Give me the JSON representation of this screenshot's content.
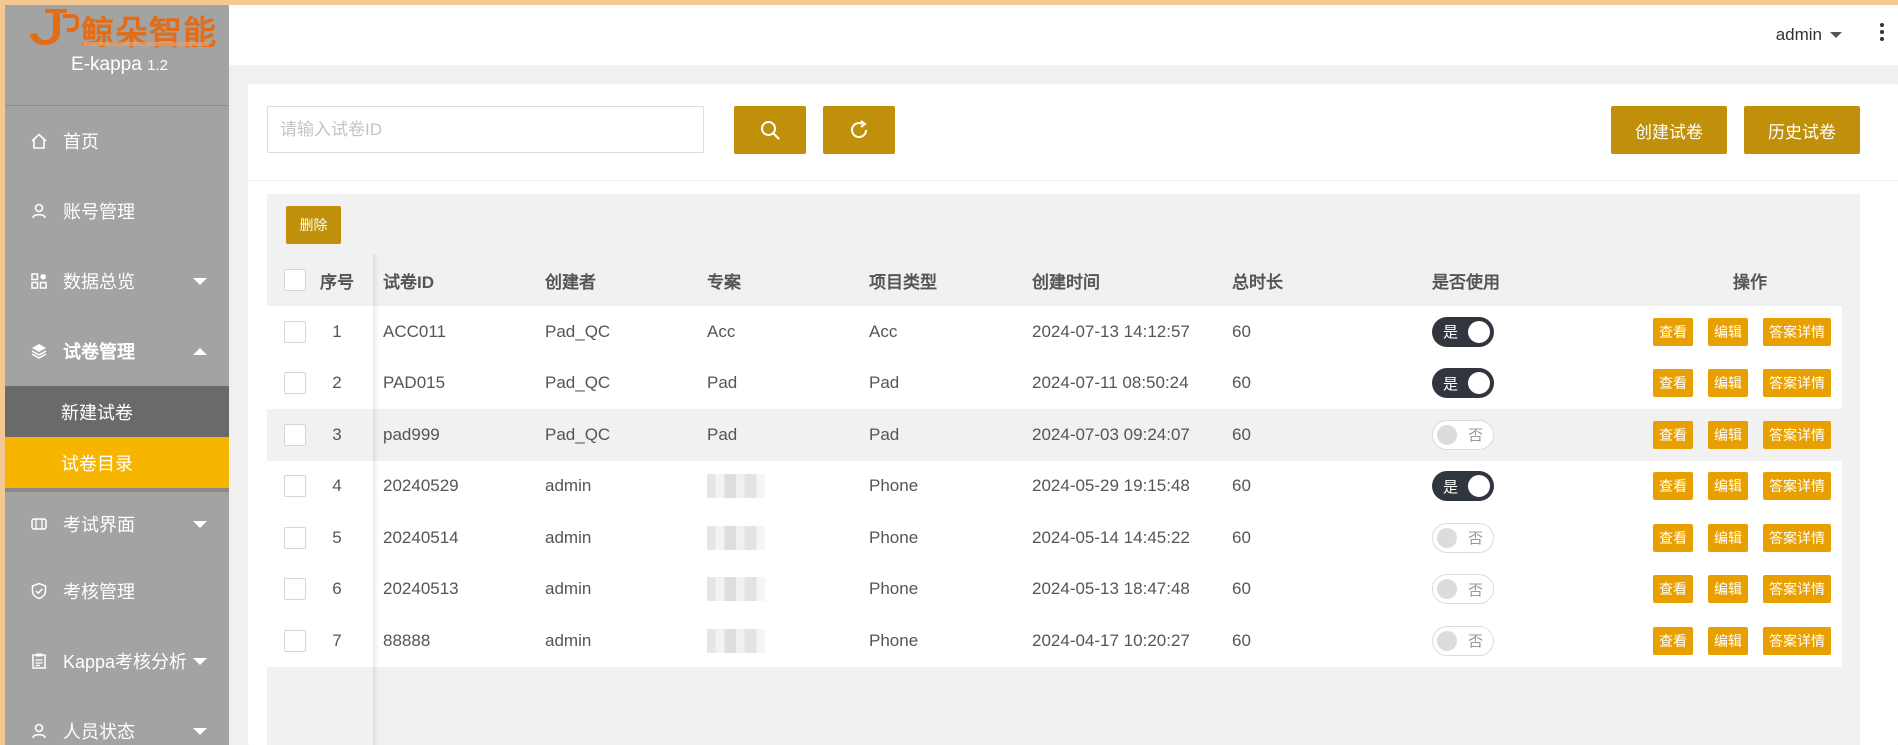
{
  "app": {
    "logo_text": "鲸朵智能",
    "name": "E-kappa",
    "version": "1.2"
  },
  "sidebar": {
    "items": [
      {
        "label": "首页",
        "icon": "home-icon"
      },
      {
        "label": "账号管理",
        "icon": "user-icon"
      },
      {
        "label": "数据总览",
        "icon": "dashboard-icon",
        "expandable": true
      },
      {
        "label": "试卷管理",
        "icon": "layers-icon",
        "expanded": true
      },
      {
        "label": "考试界面",
        "icon": "exam-icon",
        "expandable": true
      },
      {
        "label": "考核管理",
        "icon": "shield-check-icon"
      },
      {
        "label": "Kappa考核分析",
        "icon": "clipboard-icon",
        "expandable": true
      },
      {
        "label": "人员状态",
        "icon": "person-icon",
        "expandable": true
      }
    ],
    "submenu": [
      {
        "label": "新建试卷"
      },
      {
        "label": "试卷目录",
        "active": true
      }
    ]
  },
  "header": {
    "user": "admin"
  },
  "toolbar": {
    "search_placeholder": "请输入试卷ID",
    "search_value": "",
    "create_label": "创建试卷",
    "history_label": "历史试卷",
    "delete_label": "删除"
  },
  "table": {
    "columns": {
      "idx": "序号",
      "id": "试卷ID",
      "creator": "创建者",
      "project": "专案",
      "type": "项目类型",
      "created": "创建时间",
      "duration": "总时长",
      "in_use": "是否使用",
      "ops": "操作"
    },
    "toggle_on": "是",
    "toggle_off": "否",
    "op_labels": {
      "view": "查看",
      "edit": "编辑",
      "detail": "答案详情"
    },
    "rows": [
      {
        "idx": "1",
        "id": "ACC011",
        "creator": "Pad_QC",
        "project": "Acc",
        "type": "Acc",
        "created": "2024-07-13 14:12:57",
        "duration": "60",
        "in_use": true
      },
      {
        "idx": "2",
        "id": "PAD015",
        "creator": "Pad_QC",
        "project": "Pad",
        "type": "Pad",
        "created": "2024-07-11 08:50:24",
        "duration": "60",
        "in_use": true
      },
      {
        "idx": "3",
        "id": "pad999",
        "creator": "Pad_QC",
        "project": "Pad",
        "type": "Pad",
        "created": "2024-07-03 09:24:07",
        "duration": "60",
        "in_use": false
      },
      {
        "idx": "4",
        "id": "20240529",
        "creator": "admin",
        "project": "",
        "type": "Phone",
        "created": "2024-05-29 19:15:48",
        "duration": "60",
        "in_use": true
      },
      {
        "idx": "5",
        "id": "20240514",
        "creator": "admin",
        "project": "",
        "type": "Phone",
        "created": "2024-05-14 14:45:22",
        "duration": "60",
        "in_use": false
      },
      {
        "idx": "6",
        "id": "20240513",
        "creator": "admin",
        "project": "",
        "type": "Phone",
        "created": "2024-05-13 18:47:48",
        "duration": "60",
        "in_use": false
      },
      {
        "idx": "7",
        "id": "88888",
        "creator": "admin",
        "project": "",
        "type": "Phone",
        "created": "2024-04-17 10:20:27",
        "duration": "60",
        "in_use": false
      }
    ]
  },
  "colors": {
    "accent": "#c0900a",
    "op_button": "#e8a000",
    "active_menu": "#f7b500",
    "sidebar": "#a3a3a3"
  }
}
